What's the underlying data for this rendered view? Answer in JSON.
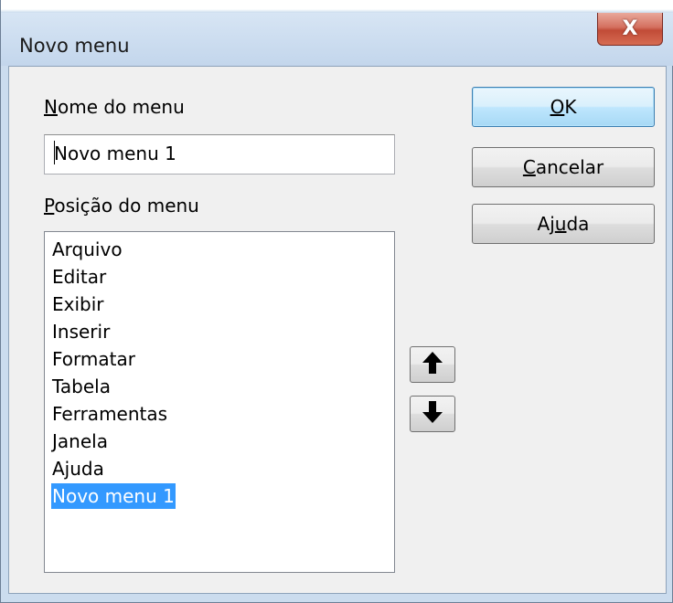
{
  "window": {
    "title": "Novo menu",
    "close_glyph": "X"
  },
  "form": {
    "name_label_accel": "N",
    "name_label_rest": "ome do menu",
    "name_value": "Novo menu 1",
    "position_label_accel": "P",
    "position_label_rest": "osição do menu",
    "menu_items": [
      "Arquivo",
      "Editar",
      "Exibir",
      "Inserir",
      "Formatar",
      "Tabela",
      "Ferramentas",
      "Janela",
      "Ajuda",
      "Novo menu 1"
    ],
    "selected_item": "Novo menu 1"
  },
  "buttons": {
    "ok_accel": "O",
    "ok_rest": "K",
    "cancel_accel": "C",
    "cancel_rest": "ancelar",
    "help_pre": "Aj",
    "help_accel": "u",
    "help_post": "da",
    "move_up_icon": "arrow-up",
    "move_down_icon": "arrow-down"
  },
  "colors": {
    "selection": "#3399ff",
    "close_button": "#c14b37",
    "default_button_border": "#3c7fb1"
  }
}
